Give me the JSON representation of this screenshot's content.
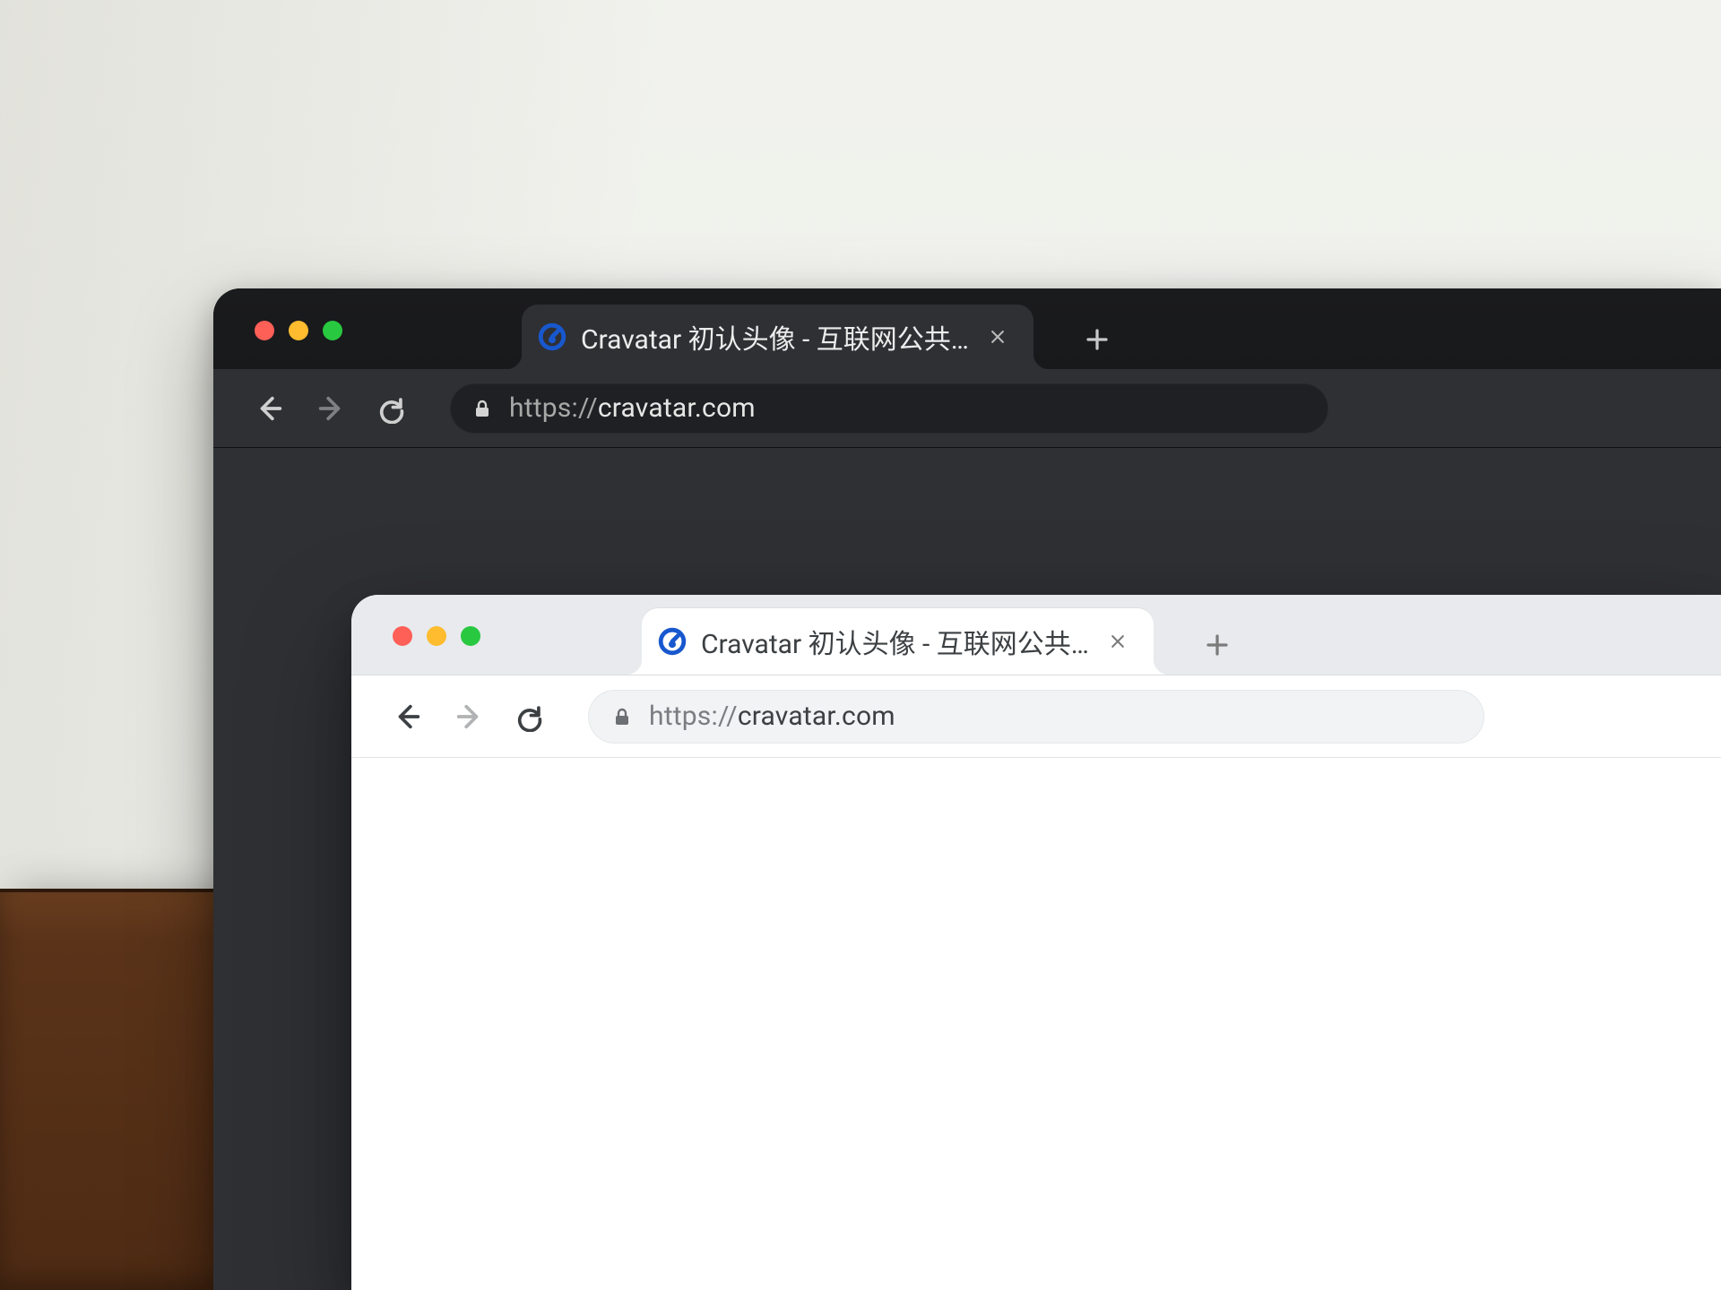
{
  "colors": {
    "traffic_red": "#FE5F57",
    "traffic_yellow": "#FEBC2E",
    "traffic_green": "#28C840",
    "favicon_blue": "#1858CE"
  },
  "dark_window": {
    "tab_title": "Cravatar 初认头像 - 互联网公共…",
    "url_scheme": "https://",
    "url_host": "cravatar.com"
  },
  "light_window": {
    "tab_title": "Cravatar 初认头像 - 互联网公共…",
    "url_scheme": "https://",
    "url_host": "cravatar.com"
  }
}
